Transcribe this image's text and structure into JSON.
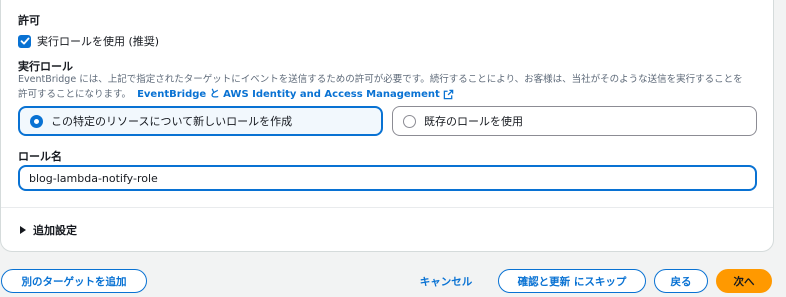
{
  "permission": {
    "title": "許可",
    "checkbox_label": "実行ロールを使用 (推奨)"
  },
  "execution_role": {
    "title": "実行ロール",
    "description_line1": "EventBridge には、上記で指定されたターゲットにイベントを送信するための許可が必要です。続行することにより、お客様は、当社がそのような送信を実行することを",
    "description_line2": "許可することになります。",
    "link_text": "EventBridge と AWS Identity and Access Management",
    "options": [
      {
        "label": "この特定のリソースについて新しいロールを作成",
        "selected": true
      },
      {
        "label": "既存のロールを使用",
        "selected": false
      }
    ]
  },
  "role_name": {
    "title": "ロール名",
    "value": "blog-lambda-notify-role"
  },
  "additional_settings": {
    "label": "追加設定"
  },
  "footer": {
    "add_target": "別のターゲットを追加",
    "cancel": "キャンセル",
    "skip_to_review": "確認と更新 にスキップ",
    "back": "戻る",
    "next": "次へ"
  },
  "colors": {
    "accent": "#0972d3",
    "primary_button": "#ff9900"
  }
}
